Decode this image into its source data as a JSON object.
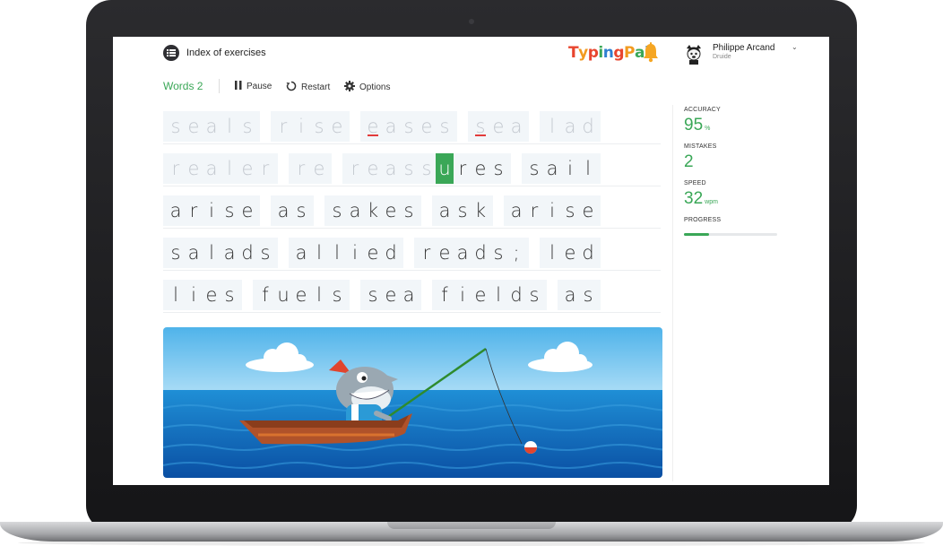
{
  "header": {
    "index_label": "Index of exercises",
    "logo_text": [
      "T",
      "y",
      "p",
      "i",
      "n",
      "g",
      "P",
      "a",
      "l"
    ],
    "user_name": "Philippe Arcand",
    "user_role": "Druide"
  },
  "toolbar": {
    "exercise_title": "Words 2",
    "pause_label": "Pause",
    "restart_label": "Restart",
    "options_label": "Options"
  },
  "typing": {
    "lines": [
      [
        {
          "text": "seals",
          "state": "typed"
        },
        {
          "text": "rise",
          "state": "typed"
        },
        {
          "text": "eases",
          "state": "typed",
          "errors": [
            0
          ]
        },
        {
          "text": "sea",
          "state": "typed",
          "errors": [
            0
          ]
        },
        {
          "text": "lad",
          "state": "typed"
        }
      ],
      [
        {
          "text": "realer",
          "state": "typed"
        },
        {
          "text": "re",
          "state": "typed"
        },
        {
          "text": "reassures",
          "state": "current",
          "cursor": 5
        },
        {
          "text": "sail",
          "state": "pending"
        }
      ],
      [
        {
          "text": "arise",
          "state": "pending"
        },
        {
          "text": "as",
          "state": "pending"
        },
        {
          "text": "sakes",
          "state": "pending"
        },
        {
          "text": "ask",
          "state": "pending"
        },
        {
          "text": "arise",
          "state": "pending"
        }
      ],
      [
        {
          "text": "salads",
          "state": "pending"
        },
        {
          "text": "allied",
          "state": "pending"
        },
        {
          "text": "reads;",
          "state": "pending"
        },
        {
          "text": "led",
          "state": "pending"
        }
      ],
      [
        {
          "text": "lies",
          "state": "pending"
        },
        {
          "text": "fuels",
          "state": "pending"
        },
        {
          "text": "sea",
          "state": "pending"
        },
        {
          "text": "fields",
          "state": "pending"
        },
        {
          "text": "as",
          "state": "pending"
        }
      ]
    ]
  },
  "stats": {
    "accuracy_label": "ACCURACY",
    "accuracy_value": "95",
    "accuracy_unit": "%",
    "mistakes_label": "MISTAKES",
    "mistakes_value": "2",
    "speed_label": "SPEED",
    "speed_value": "32",
    "speed_unit": "wpm",
    "progress_label": "PROGRESS",
    "progress_fraction": 0.27
  },
  "colors": {
    "accent_green": "#3aa757",
    "error_red": "#e23b3b",
    "bell_orange": "#f5a623",
    "logo_colors": [
      "#e8452e",
      "#f29a1f",
      "#e8452e",
      "#3aa757",
      "#2f7fd1",
      "#e8452e",
      "#f29a1f",
      "#3aa757",
      "#2f7fd1"
    ]
  },
  "icons": {
    "menu": "list-icon",
    "notification": "bell-icon",
    "avatar": "dog-avatar",
    "pause": "pause-icon",
    "restart": "restart-icon",
    "options": "gear-icon",
    "dropdown": "chevron-down-icon"
  }
}
